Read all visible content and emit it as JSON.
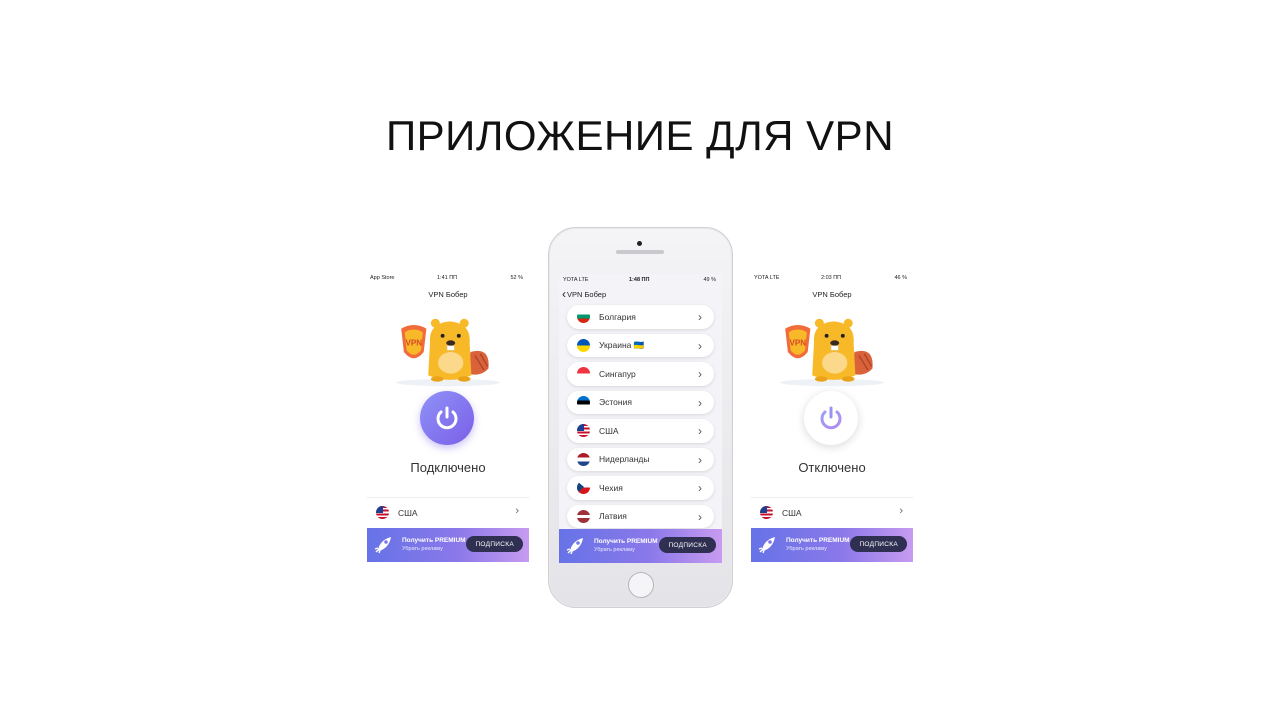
{
  "slide": {
    "title": "ПРИЛОЖЕНИЕ ДЛЯ VPN"
  },
  "left": {
    "status_bar": {
      "carrier": "App Store",
      "time": "1:41 ПП",
      "battery": "52 %"
    },
    "app_title": "VPN Бобер",
    "status": "Подключено",
    "country": "США",
    "promo": {
      "line1": "Получить PREMIUM",
      "line2": "Убрать рекламу",
      "button": "ПОДПИСКА"
    }
  },
  "center": {
    "status_bar": {
      "carrier": "YOTA LTE",
      "time": "1:48 ПП",
      "battery": "49 %"
    },
    "back_label": "VPN Бобер",
    "countries": [
      {
        "name": "Болгария",
        "flag": "bg"
      },
      {
        "name": "Украина 🇺🇦",
        "flag": "ua"
      },
      {
        "name": "Сингапур",
        "flag": "sg"
      },
      {
        "name": "Эстония",
        "flag": "ee"
      },
      {
        "name": "США",
        "flag": "us"
      },
      {
        "name": "Нидерланды",
        "flag": "nl"
      },
      {
        "name": "Чехия",
        "flag": "cz"
      },
      {
        "name": "Латвия",
        "flag": "lv"
      }
    ],
    "promo": {
      "line1": "Получить PREMIUM",
      "line2": "Убрать рекламу",
      "button": "ПОДПИСКА"
    }
  },
  "right": {
    "status_bar": {
      "carrier": "YOTA LTE",
      "time": "2:03 ПП",
      "battery": "46 %"
    },
    "app_title": "VPN Бобер",
    "status": "Отключено",
    "country": "США",
    "promo": {
      "line1": "Получить PREMIUM",
      "line2": "Убрать рекламу",
      "button": "ПОДПИСКА"
    }
  },
  "colors": {
    "accent": "#7b6ff0",
    "promo_start": "#6673e6",
    "promo_end": "#c79bf0",
    "button_dark": "#2f2f52",
    "beaver": "#f7b928"
  }
}
